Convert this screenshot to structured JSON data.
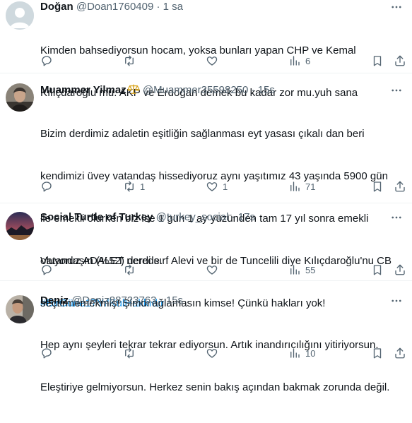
{
  "colors": {
    "text": "#0f1419",
    "secondary": "#536471",
    "link": "#1d9bf0",
    "divider": "#eff3f4"
  },
  "tweets": [
    {
      "name": "Doğan",
      "handle": "@Doan1760409",
      "dot": "·",
      "time": "1 sa",
      "lines": [
        "Kimden bahsediyorsun hocam, yoksa bunları yapan CHP ve Kemal",
        "Kılıçdaroğlu mu. AKP ve Erdoğan demek bu kadar zor mu.yuh sana"
      ],
      "hashtag": "",
      "reply_count": "",
      "retweet_count": "",
      "like_count": "",
      "views_count": "6"
    },
    {
      "name": "Muammer Yilmaz",
      "handle": "@Muammer35598250",
      "dot": "·",
      "time": "15s",
      "badge_icon": "scales-emoji",
      "lines": [
        "Bizim derdimiz adaletin eşitliğin sağlanması eyt yasası çıkalı dan beri",
        "kendimizi üvey vatandaş hissediyoruz aynı yaşıtımız 43 yaşında 5900 gün",
        "ile emekli olurken biz ise 1 gün 1 ay yüzünden tam 17 yıl sonra emekli",
        "oluyoruz ADALET nerede."
      ],
      "hashtag": "#BirGüne17YılKulHakkıdır",
      "reply_count": "",
      "retweet_count": "1",
      "like_count": "1",
      "views_count": "71"
    },
    {
      "name": "Social Turtle of Turkey",
      "handle": "@turkey_social",
      "dot": "·",
      "time": "17s",
      "lines": [
        "Vatandaşın (%52) derdi sırf Alevi ve bir de Tuncelili diye Kılıçdaroğlu'nu CB",
        "seçtirmemekmiş! Şimdi ağlamasın kimse! Çünkü hakları yok!"
      ],
      "hashtag": "",
      "reply_count": "",
      "retweet_count": "",
      "like_count": "",
      "views_count": "55"
    },
    {
      "name": "Deniz",
      "handle": "@Deniz88723763",
      "dot": "·",
      "time": "15s",
      "lines": [
        "Hep aynı şeyleri tekrar tekrar ediyorsun. Artık inandırıcılığını yitiriyorsun.",
        "Eleştiriye gelmiyorsun. Herkez senin bakış açından bakmak zorunda değil."
      ],
      "hashtag": "",
      "reply_count": "",
      "retweet_count": "",
      "like_count": "",
      "views_count": "10"
    }
  ]
}
